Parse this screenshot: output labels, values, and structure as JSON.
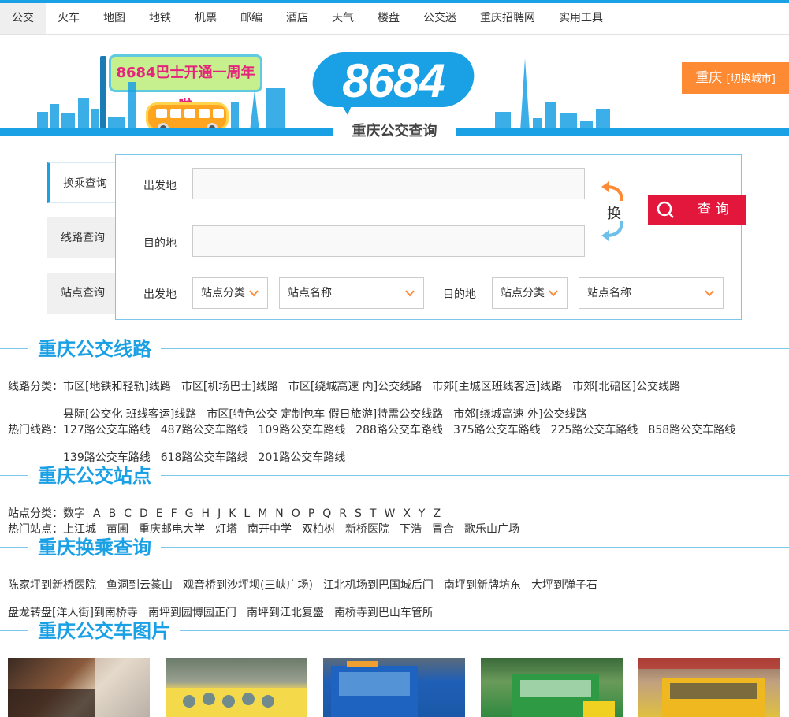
{
  "nav": [
    "公交",
    "火车",
    "地图",
    "地铁",
    "机票",
    "邮编",
    "酒店",
    "天气",
    "楼盘",
    "公交迷",
    "重庆招聘网",
    "实用工具"
  ],
  "header": {
    "logo_text": "8684",
    "site_name": "重庆公交查询",
    "promo": "8684巴士开通一周年啦",
    "city": "重庆",
    "city_switch": "[切换城市]"
  },
  "search": {
    "tabs": [
      "换乘查询",
      "线路查询",
      "站点查询"
    ],
    "from_label": "出发地",
    "to_label": "目的地",
    "swap_label": "换",
    "query_label": "查询",
    "station_from_label": "出发地",
    "station_to_label": "目的地",
    "sel_category": "站点分类",
    "sel_name": "站点名称"
  },
  "colors": {
    "accent": "#1aa0e5",
    "query": "#e3163b",
    "city": "#ff8a34"
  },
  "sections": {
    "lines": {
      "title": "重庆公交线路",
      "cat_label": "线路分类：",
      "categories_row1": [
        "市区[地铁和轻轨]线路",
        "市区[机场巴士]线路",
        "市区[绕城高速 内]公交线路",
        "市郊[主城区班线客运]线路",
        "市郊[北碚区]公交线路"
      ],
      "categories_row2": [
        "县际[公交化 班线客运]线路",
        "市区[特色公交 定制包车 假日旅游]特需公交线路",
        "市郊[绕城高速 外]公交线路"
      ],
      "hot_label": "热门线路：",
      "hot_row1": [
        "127路公交车路线",
        "487路公交车路线",
        "109路公交车路线",
        "288路公交车路线",
        "375路公交车路线",
        "225路公交车路线",
        "858路公交车路线"
      ],
      "hot_row2": [
        "139路公交车路线",
        "618路公交车路线",
        "201路公交车路线"
      ]
    },
    "stations": {
      "title": "重庆公交站点",
      "cat_label": "站点分类：",
      "letters": [
        "数字",
        "A",
        "B",
        "C",
        "D",
        "E",
        "F",
        "G",
        "H",
        "J",
        "K",
        "L",
        "M",
        "N",
        "O",
        "P",
        "Q",
        "R",
        "S",
        "T",
        "W",
        "X",
        "Y",
        "Z"
      ],
      "hot_label": "热门站点：",
      "hot": [
        "上江城",
        "苗圃",
        "重庆邮电大学",
        "灯塔",
        "南开中学",
        "双柏树",
        "新桥医院",
        "下浩",
        "冒合",
        "歌乐山广场"
      ]
    },
    "transfer": {
      "title": "重庆换乘查询",
      "row1": [
        "陈家坪到新桥医院",
        "鱼洞到云篆山",
        "观音桥到沙坪坝(三峡广场)",
        "江北机场到巴国城后门",
        "南坪到新牌坊东",
        "大坪到弹子石"
      ],
      "row2": [
        "盘龙转盘[洋人街]到南桥寺",
        "南坪到园博园正门",
        "南坪到江北复盛",
        "南桥寺到巴山车管所"
      ]
    },
    "photos": {
      "title": "重庆公交车图片"
    }
  }
}
